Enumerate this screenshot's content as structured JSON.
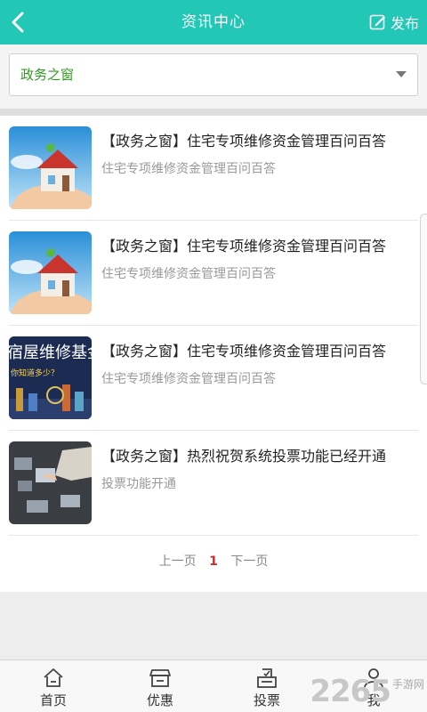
{
  "header": {
    "title": "资讯中心",
    "publish_label": "发布",
    "back_icon": "back-arrow-icon",
    "publish_icon": "edit-icon"
  },
  "filter": {
    "selected": "政务之窗"
  },
  "articles": [
    {
      "title": "【政务之窗】住宅专项维修资金管理百问百答",
      "summary": "住宅专项维修资金管理百问百答",
      "thumb": "house-illustration"
    },
    {
      "title": "【政务之窗】住宅专项维修资金管理百问百答",
      "summary": "住宅专项维修资金管理百问百答",
      "thumb": "house-illustration"
    },
    {
      "title": "【政务之窗】住宅专项维修资金管理百问百答",
      "summary": "住宅专项维修资金管理百问百答",
      "thumb": "maintenance-fund-poster",
      "thumb_text": "宿屋维修基金",
      "thumb_subtext": "你知道多少？"
    },
    {
      "title": "【政务之窗】热烈祝贺系统投票功能已经开通",
      "summary": "投票功能开通",
      "thumb": "touchscreen-hand"
    }
  ],
  "pagination": {
    "prev": "上一页",
    "current": "1",
    "next": "下一页"
  },
  "tabbar": {
    "items": [
      {
        "label": "首页",
        "icon": "home-icon"
      },
      {
        "label": "优惠",
        "icon": "shop-icon"
      },
      {
        "label": "投票",
        "icon": "vote-box-icon"
      },
      {
        "label": "我",
        "icon": "user-icon"
      }
    ]
  },
  "watermark": {
    "number": "2265",
    "site": "手游网"
  },
  "colors": {
    "header": "#23c7b6",
    "filter_text": "#2f9b1f",
    "current_page": "#d8282f"
  }
}
